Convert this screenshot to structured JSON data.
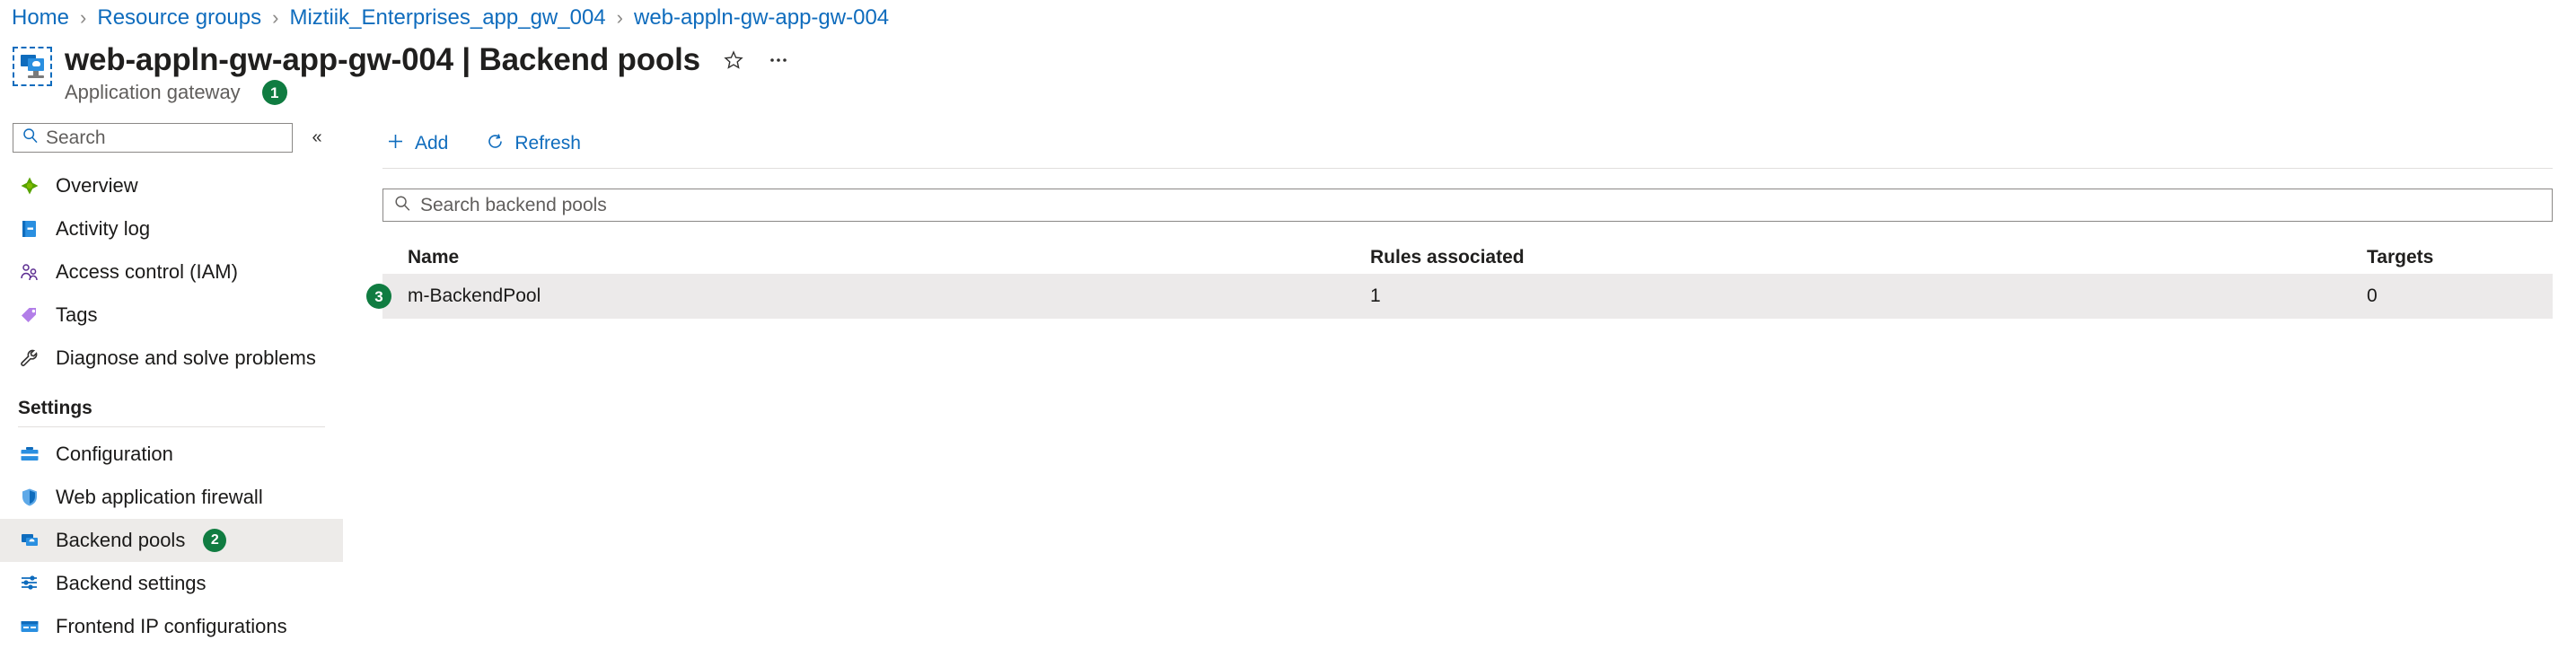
{
  "breadcrumb": {
    "items": [
      {
        "label": "Home"
      },
      {
        "label": "Resource groups"
      },
      {
        "label": "Miztiik_Enterprises_app_gw_004"
      },
      {
        "label": "web-appln-gw-app-gw-004"
      }
    ],
    "separator": "›"
  },
  "header": {
    "title": "web-appln-gw-app-gw-004 | Backend pools",
    "subtitle": "Application gateway",
    "resource_icon": "application-gateway-icon",
    "favorite_icon": "star-outline-icon",
    "more_icon": "ellipsis-icon",
    "step_badge": "1"
  },
  "sidebar": {
    "search": {
      "placeholder": "Search",
      "value": "",
      "icon": "search-icon"
    },
    "collapse_icon": "«",
    "items": [
      {
        "label": "Overview",
        "icon": "overview-icon",
        "selected": false
      },
      {
        "label": "Activity log",
        "icon": "activity-log-icon",
        "selected": false
      },
      {
        "label": "Access control (IAM)",
        "icon": "access-control-icon",
        "selected": false
      },
      {
        "label": "Tags",
        "icon": "tags-icon",
        "selected": false
      },
      {
        "label": "Diagnose and solve problems",
        "icon": "wrench-icon",
        "selected": false
      }
    ],
    "settings_group": {
      "title": "Settings",
      "items": [
        {
          "label": "Configuration",
          "icon": "configuration-icon",
          "selected": false,
          "badge": ""
        },
        {
          "label": "Web application firewall",
          "icon": "shield-icon",
          "selected": false,
          "badge": ""
        },
        {
          "label": "Backend pools",
          "icon": "backend-pools-icon",
          "selected": true,
          "badge": "2"
        },
        {
          "label": "Backend settings",
          "icon": "backend-settings-icon",
          "selected": false,
          "badge": ""
        },
        {
          "label": "Frontend IP configurations",
          "icon": "frontend-ip-icon",
          "selected": false,
          "badge": ""
        }
      ]
    }
  },
  "toolbar": {
    "add_label": "Add",
    "add_icon": "plus-icon",
    "refresh_label": "Refresh",
    "refresh_icon": "refresh-icon"
  },
  "content_search": {
    "placeholder": "Search backend pools",
    "value": "",
    "icon": "search-icon"
  },
  "table": {
    "columns": [
      "Name",
      "Rules associated",
      "Targets"
    ],
    "rows": [
      {
        "name": "m-BackendPool",
        "rules_associated": "1",
        "targets": "0",
        "badge": "3"
      }
    ]
  },
  "colors": {
    "link": "#0f6cbd",
    "badge_green": "#107c41",
    "row_selected": "#eceaea",
    "nav_selected": "#edebe9"
  }
}
